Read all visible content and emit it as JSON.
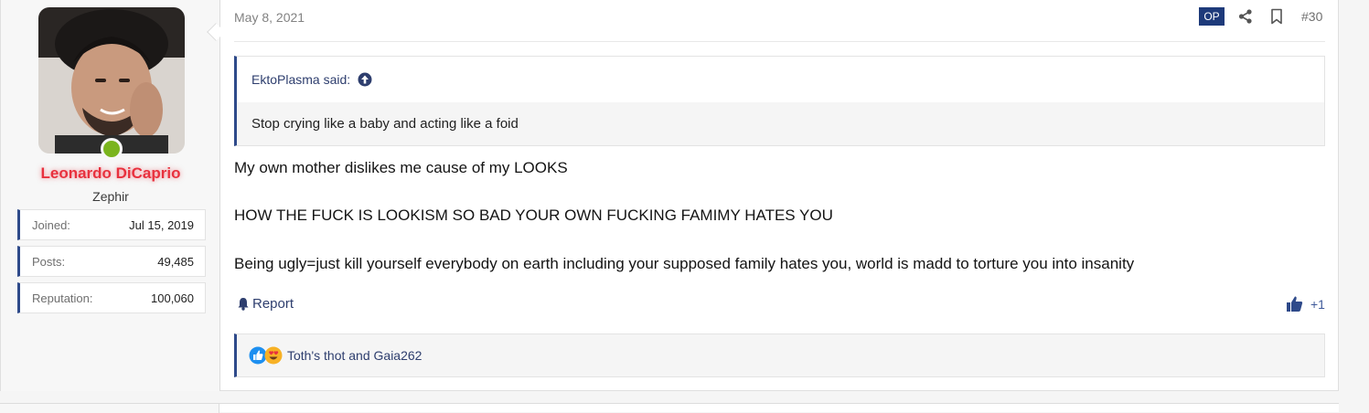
{
  "user": {
    "name": "Leonardo DiCaprio",
    "title": "Zephir",
    "online": true,
    "stats": [
      {
        "label": "Joined:",
        "value": "Jul 15, 2019"
      },
      {
        "label": "Posts:",
        "value": "49,485"
      },
      {
        "label": "Reputation:",
        "value": "100,060"
      }
    ]
  },
  "post": {
    "date": "May 8, 2021",
    "op_badge": "OP",
    "number": "#30",
    "quote": {
      "author": "EktoPlasma said:",
      "text": "Stop crying like a baby and acting like a foid"
    },
    "body": [
      "My own mother dislikes me cause of my LOOKS",
      "HOW THE FUCK IS LOOKISM SO BAD YOUR OWN FUCKING FAMIMY HATES YOU",
      "Being ugly=just kill yourself everybody on earth including your supposed family hates you, world is madd to torture you into insanity"
    ],
    "report_label": "Report",
    "like_label": "+1",
    "reactors": "Toth's thot and Gaia262"
  },
  "colors": {
    "accent": "#2e4a8a",
    "username": "#e8313e",
    "online": "#7ab41d",
    "op_badge": "#1e3a7a"
  },
  "icons": [
    "share-icon",
    "bookmark-icon",
    "arrow-up-circle-icon",
    "bell-icon",
    "thumbs-up-icon",
    "like-reaction-icon",
    "love-reaction-icon"
  ]
}
